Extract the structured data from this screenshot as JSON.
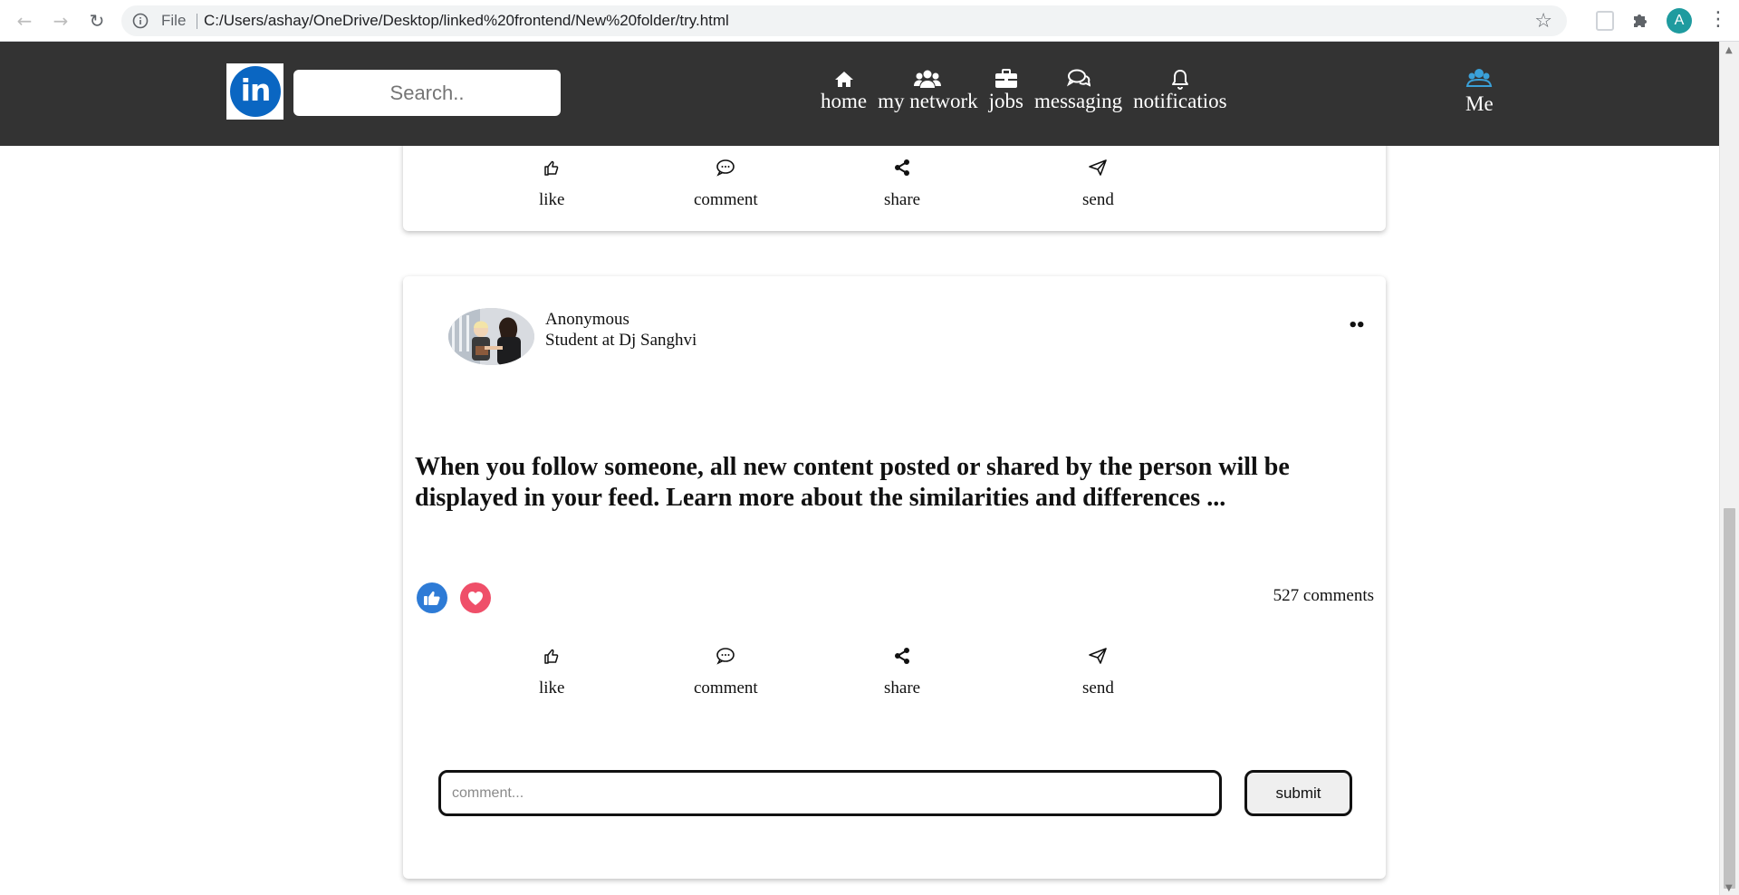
{
  "browser": {
    "scheme_label": "File",
    "url": "C:/Users/ashay/OneDrive/Desktop/linked%20frontend/New%20folder/try.html",
    "profile_initial": "A"
  },
  "nav": {
    "logo_text": "in",
    "search_placeholder": "Search..",
    "items": [
      {
        "label": "home",
        "icon": "home-icon"
      },
      {
        "label": "my network",
        "icon": "users-icon"
      },
      {
        "label": "jobs",
        "icon": "briefcase-icon"
      },
      {
        "label": "messaging",
        "icon": "chat-icon"
      },
      {
        "label": "notificatios",
        "icon": "bell-icon"
      }
    ],
    "me_label": "Me"
  },
  "actions": {
    "like": "like",
    "comment": "comment",
    "share": "share",
    "send": "send"
  },
  "post": {
    "author_name": "Anonymous",
    "author_title": "Student at Dj Sanghvi",
    "more_label": "••",
    "text": "When you follow someone, all new content posted or shared by the person will be displayed in your feed. Learn more about the similarities and differences ...",
    "comments_count": "527 comments",
    "comment_placeholder": "comment...",
    "submit_label": "submit"
  },
  "colors": {
    "navbar_bg": "#333333",
    "linkedin_blue": "#0a66c2",
    "like_blue": "#2e7bd6",
    "love_red": "#ef4f69"
  }
}
